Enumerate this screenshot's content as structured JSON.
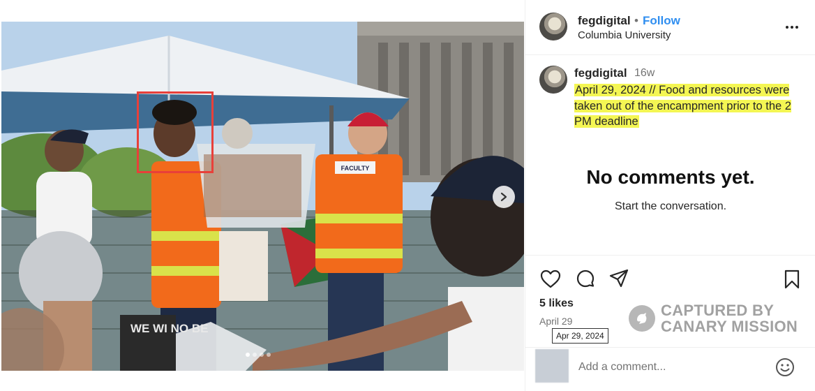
{
  "post": {
    "username": "fegdigital",
    "follow_label": "Follow",
    "location": "Columbia University"
  },
  "caption": {
    "username": "fegdigital",
    "time_ago": "16w",
    "text": "April 29, 2024 // Food and resources were taken out of the encampment prior to the 2 PM deadline"
  },
  "comments": {
    "empty_title": "No comments yet.",
    "empty_subtitle": "Start the conversation."
  },
  "engagement": {
    "likes": "5 likes",
    "date": "April 29",
    "date_tooltip": "Apr 29, 2024"
  },
  "watermark": {
    "line1": "CAPTURED BY",
    "line2": "CANARY MISSION"
  },
  "comment_box": {
    "placeholder": "Add a comment..."
  },
  "carousel": {
    "slide_count": 4,
    "active_index": 0
  },
  "photo_signs": {
    "vest_label": "FACULTY",
    "banner_text": "WE WI NO BE"
  },
  "colors": {
    "follow": "#2f8ef0",
    "highlight": "#f4f653",
    "annotation_box": "#e8403a"
  },
  "icons": [
    "more-options-icon",
    "heart-icon",
    "comment-icon",
    "share-icon",
    "bookmark-icon",
    "chevron-right-icon",
    "emoji-icon",
    "canary-logo-icon"
  ]
}
